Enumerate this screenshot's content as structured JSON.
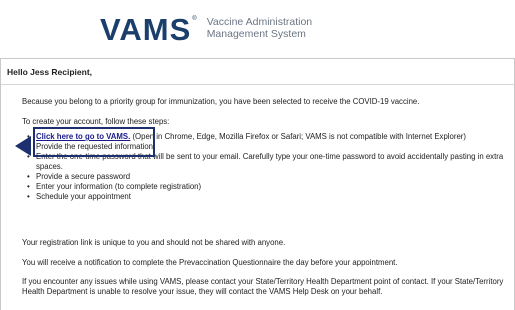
{
  "header": {
    "logo_text": "VAMS",
    "logo_reg": "®",
    "subtitle_line1": "Vaccine Administration",
    "subtitle_line2": "Management System"
  },
  "email": {
    "greeting": "Hello Jess Recipient,",
    "intro": "Because you belong to a priority group for immunization, you have been selected to receive the COVID-19 vaccine.",
    "steps_heading": "To create your account, follow these steps:",
    "link_text": "Click here to go to VAMS.",
    "link_note": " (Open in Chrome, Edge, Mozilla Firefox or Safari; VAMS is not compatible with Internet Explorer)",
    "steps": [
      "Provide the requested information",
      "Enter the one-time password that will be sent to your email. Carefully type your one-time password to avoid accidentally pasting in extra spaces.",
      "Provide a secure password",
      "Enter your information (to complete registration)",
      "Schedule your appointment"
    ],
    "unique_link": "Your registration link is unique to you and should not be shared with anyone.",
    "notification": "You will receive a notification to complete the Prevaccination Questionnaire the day before your appointment.",
    "issues": "If you encounter any issues while using VAMS, please contact your State/Territory Health Department point of contact. If your State/Territory Health Department is unable to resolve your issue, they will contact the VAMS Help Desk on your behalf."
  }
}
